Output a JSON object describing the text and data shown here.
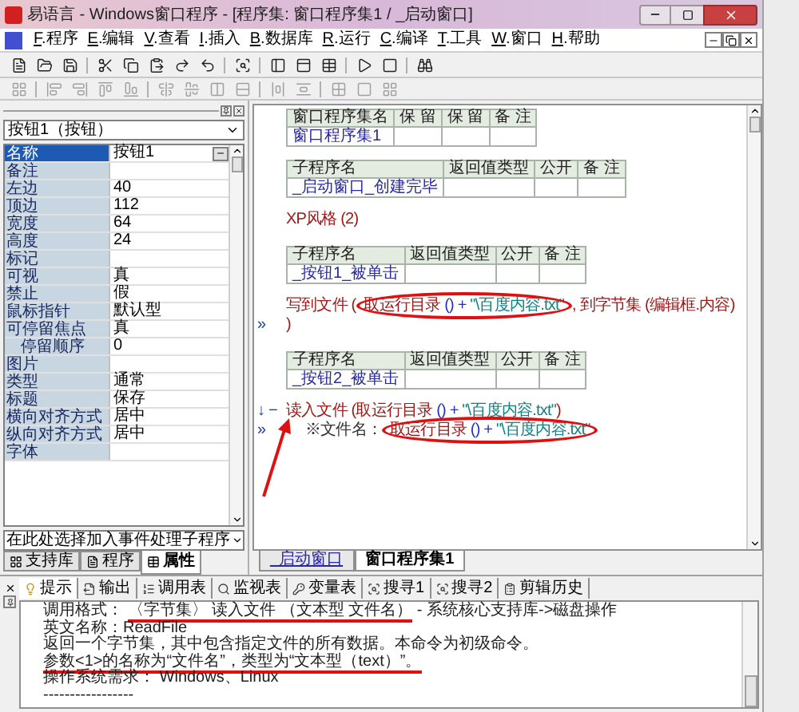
{
  "window": {
    "title": "易语言 - Windows窗口程序 - [程序集: 窗口程序集1 / _启动窗口]"
  },
  "menu": [
    {
      "label": "F.程序"
    },
    {
      "label": "E.编辑"
    },
    {
      "label": "V.查看"
    },
    {
      "label": "I.插入"
    },
    {
      "label": "B.数据库"
    },
    {
      "label": "R.运行"
    },
    {
      "label": "C.编译"
    },
    {
      "label": "T.工具"
    },
    {
      "label": "W.窗口"
    },
    {
      "label": "H.帮助"
    }
  ],
  "properties": {
    "object": "按钮1（按钮）",
    "rows": [
      {
        "name": "名称",
        "value": "按钮1",
        "selected": true
      },
      {
        "name": "备注",
        "selected": false
      },
      {
        "name": "左边",
        "value": "40",
        "selected": false
      },
      {
        "name": "顶边",
        "value": "112",
        "selected": false
      },
      {
        "name": "宽度",
        "value": "64",
        "selected": false
      },
      {
        "name": "高度",
        "value": "24",
        "selected": false
      },
      {
        "name": "标记",
        "selected": false
      },
      {
        "name": "可视",
        "value": "真",
        "selected": false
      },
      {
        "name": "禁止",
        "value": "假",
        "selected": false
      },
      {
        "name": "鼠标指针",
        "value": "默认型",
        "selected": false
      },
      {
        "name": "可停留焦点",
        "value": "真",
        "selected": false,
        "children": [
          {
            "name": "停留顺序",
            "value": "0",
            "selected": false
          }
        ]
      },
      {
        "name": "图片",
        "selected": false
      },
      {
        "name": "类型",
        "value": "通常",
        "selected": false
      },
      {
        "name": "标题",
        "value": "保存",
        "selected": false
      },
      {
        "name": "横向对齐方式",
        "value": "居中",
        "selected": false
      },
      {
        "name": "纵向对齐方式",
        "value": "居中",
        "selected": false
      },
      {
        "name": "字体",
        "selected": false
      }
    ],
    "event_select": "在此处选择加入事件处理子程序"
  },
  "left_tabs": [
    {
      "label": "支持库",
      "selected": false
    },
    {
      "label": "程序",
      "selected": false
    },
    {
      "label": "属性",
      "selected": true
    }
  ],
  "editor": {
    "blocks": [
      {
        "kind": "table",
        "columns": [
          "窗口程序集名",
          "保 留",
          "保 留",
          "备 注"
        ],
        "rows": [
          {
            "cells": [
              "窗口程序集1"
            ]
          }
        ]
      },
      {
        "kind": "table",
        "columns": [
          "子程序名",
          "返回值类型",
          "公开",
          "备 注"
        ],
        "rows": [
          {
            "cells": [
              "_启动窗口_创建完毕"
            ]
          }
        ]
      },
      {
        "kind": "code",
        "segments": [
          {
            "circled": false,
            "parts": [
              {
                "text": "XP风格 (2)",
                "kind": "command"
              }
            ]
          }
        ]
      },
      {
        "kind": "table",
        "columns": [
          "子程序名",
          "返回值类型",
          "公开",
          "备 注"
        ],
        "rows": [
          {
            "cells": [
              "_按钮1_被单击"
            ]
          }
        ]
      },
      {
        "kind": "code",
        "segments": [
          {
            "circled": false,
            "parts": [
              {
                "text": "写到文件 (",
                "kind": "command"
              }
            ]
          },
          {
            "circled": true,
            "parts": [
              {
                "text": "取运行目录",
                "kind": "command"
              },
              {
                "text": " () + ",
                "kind": "operator"
              },
              {
                "text": "\"\\百度内容.txt\"",
                "kind": "string"
              }
            ]
          },
          {
            "circled": false,
            "parts": [
              {
                "text": ", 到字节集 (编辑框.内容)",
                "kind": "command"
              }
            ]
          }
        ]
      },
      {
        "kind": "code",
        "gutter": "»",
        "segments": [
          {
            "circled": false,
            "parts": [
              {
                "text": ")",
                "kind": "command"
              }
            ]
          }
        ]
      },
      {
        "kind": "table",
        "columns": [
          "子程序名",
          "返回值类型",
          "公开",
          "备 注"
        ],
        "rows": [
          {
            "cells": [
              "_按钮2_被单击"
            ]
          }
        ]
      },
      {
        "kind": "code",
        "gutter": "↓ −",
        "segments": [
          {
            "circled": false,
            "pointed": true,
            "parts": [
              {
                "text": "读入文件 (取运行目录",
                "kind": "command"
              },
              {
                "text": " () + ",
                "kind": "operator"
              },
              {
                "text": "\"\\百度内容.txt\"",
                "kind": "string"
              },
              {
                "text": ")",
                "kind": "command"
              }
            ]
          }
        ]
      },
      {
        "kind": "hint",
        "gutter": "»",
        "segments": [
          {
            "circled": false,
            "parts": [
              {
                "text": "※文件名：",
                "kind": "plain"
              }
            ]
          },
          {
            "circled": true,
            "parts": [
              {
                "text": "取运行目录",
                "kind": "command"
              },
              {
                "text": " () + ",
                "kind": "operator"
              },
              {
                "text": "\"\\百度内容.txt\"",
                "kind": "string"
              }
            ]
          }
        ]
      }
    ]
  },
  "editor_tabs": [
    {
      "label": "_启动窗口",
      "selected": false
    },
    {
      "label": "窗口程序集1",
      "selected": true
    }
  ],
  "bottom_tabs": [
    {
      "label": "提示",
      "selected": true
    },
    {
      "label": "输出",
      "selected": false
    },
    {
      "label": "调用表",
      "selected": false
    },
    {
      "label": "监视表",
      "selected": false
    },
    {
      "label": "变量表",
      "selected": false
    },
    {
      "label": "搜寻1",
      "selected": false
    },
    {
      "label": "搜寻2",
      "selected": false
    },
    {
      "label": "剪辑历史",
      "selected": false
    }
  ],
  "hint_lines": [
    {
      "parts": [
        {
          "text": "调用格式： ",
          "underlined": false
        },
        {
          "text": "〈字节集〉 读入文件 （文本型 文件名）",
          "underlined": true
        },
        {
          "text": " - 系统核心支持库->磁盘操作",
          "underlined": false
        }
      ]
    },
    {
      "parts": [
        {
          "text": "英文名称：ReadFile",
          "underlined": false
        }
      ]
    },
    {
      "parts": [
        {
          "text": "返回一个字节集，其中包含指定文件的所有数据。本命令为初级命令。",
          "underlined": false
        }
      ]
    },
    {
      "parts": [
        {
          "text": "参数<1>的名称为“文件名”，类型为“文本型（text）”。",
          "underlined": true
        }
      ]
    },
    {
      "parts": [
        {
          "text": "操作系统需求： Windows、Linux",
          "underlined": false
        }
      ]
    },
    {
      "parts": [
        {
          "text": "-----------------",
          "underlined": false
        }
      ]
    }
  ]
}
